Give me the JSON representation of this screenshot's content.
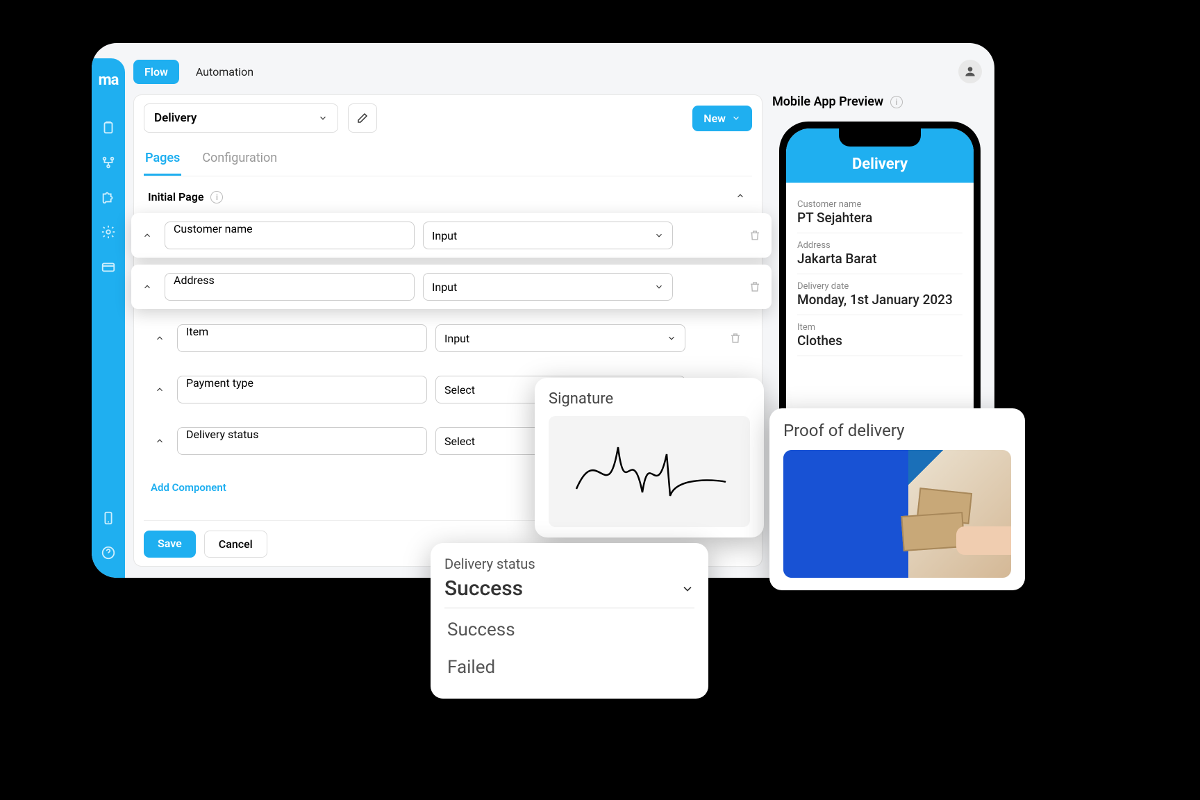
{
  "logo": "ma",
  "topbar": {
    "flow": "Flow",
    "automation": "Automation"
  },
  "main": {
    "flowName": "Delivery",
    "newBtn": "New",
    "tabs": {
      "pages": "Pages",
      "configuration": "Configuration"
    },
    "sectionTitle": "Initial Page",
    "fields": [
      {
        "name": "Customer name",
        "type": "Input"
      },
      {
        "name": "Address",
        "type": "Input"
      },
      {
        "name": "Item",
        "type": "Input"
      },
      {
        "name": "Payment type",
        "type": "Select"
      },
      {
        "name": "Delivery status",
        "type": "Select"
      }
    ],
    "addComponent": "Add Component",
    "save": "Save",
    "cancel": "Cancel"
  },
  "preview": {
    "title": "Mobile App Preview",
    "headerTitle": "Delivery",
    "fields": [
      {
        "label": "Customer name",
        "value": "PT Sejahtera"
      },
      {
        "label": "Address",
        "value": "Jakarta Barat"
      },
      {
        "label": "Delivery date",
        "value": "Monday, 1st January 2023"
      },
      {
        "label": "Item",
        "value": "Clothes"
      }
    ]
  },
  "signatureCard": {
    "title": "Signature"
  },
  "statusCard": {
    "label": "Delivery status",
    "selected": "Success",
    "options": [
      "Success",
      "Failed"
    ]
  },
  "proofCard": {
    "title": "Proof of delivery"
  }
}
